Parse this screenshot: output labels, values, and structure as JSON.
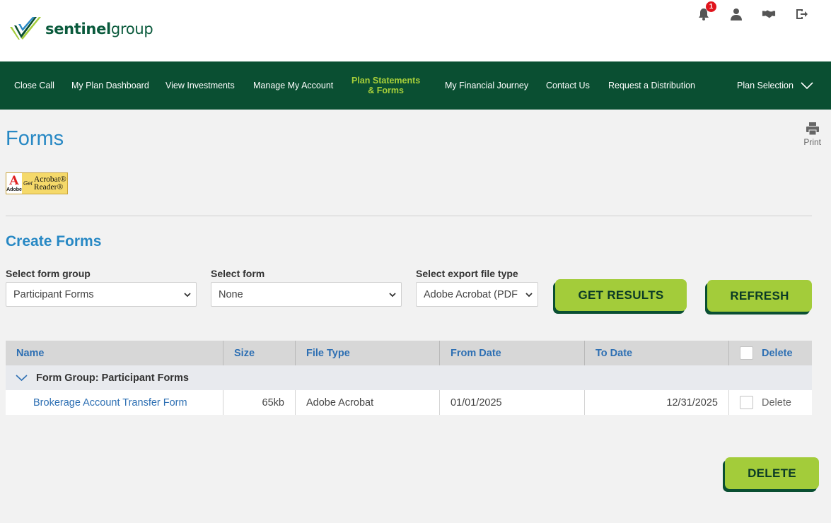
{
  "brand": {
    "name_bold": "sentinel",
    "name_light": "group",
    "colors": {
      "dark_green": "#0a4f32",
      "lime": "#a3cc3a",
      "blue": "#2788c4"
    }
  },
  "top_icons": {
    "notification_count": "1",
    "icons": [
      "bell-icon",
      "user-icon",
      "handshake-icon",
      "logout-icon"
    ]
  },
  "nav": {
    "items": [
      "Close Call",
      "My Plan Dashboard",
      "View Investments",
      "Manage My Account",
      "Plan Statements",
      "My Financial Journey",
      "Contact Us",
      "Request a Distribution",
      "Plan Selection"
    ],
    "active_line2": "& Forms"
  },
  "page": {
    "title": "Forms",
    "print_label": "Print"
  },
  "acrobat_badge": {
    "adobe": "Adobe",
    "get": "Get",
    "line1": "Acrobat®",
    "line2": "Reader®"
  },
  "create_forms": {
    "title": "Create Forms",
    "form_group_label": "Select form group",
    "form_group_value": "Participant Forms",
    "form_label": "Select form",
    "form_value": "None",
    "export_label": "Select export file type",
    "export_value": "Adobe Acrobat (PDF",
    "get_results": "GET RESULTS",
    "refresh": "REFRESH"
  },
  "table": {
    "columns": [
      "Name",
      "Size",
      "File Type",
      "From Date",
      "To Date",
      "Delete"
    ],
    "group_label": "Form Group: Participant Forms",
    "rows": [
      {
        "name": "Brokerage Account Transfer Form",
        "size": "65kb",
        "file_type": "Adobe Acrobat",
        "from_date": "01/01/2025",
        "to_date": "12/31/2025",
        "delete": "Delete"
      }
    ]
  },
  "delete_button": "DELETE"
}
